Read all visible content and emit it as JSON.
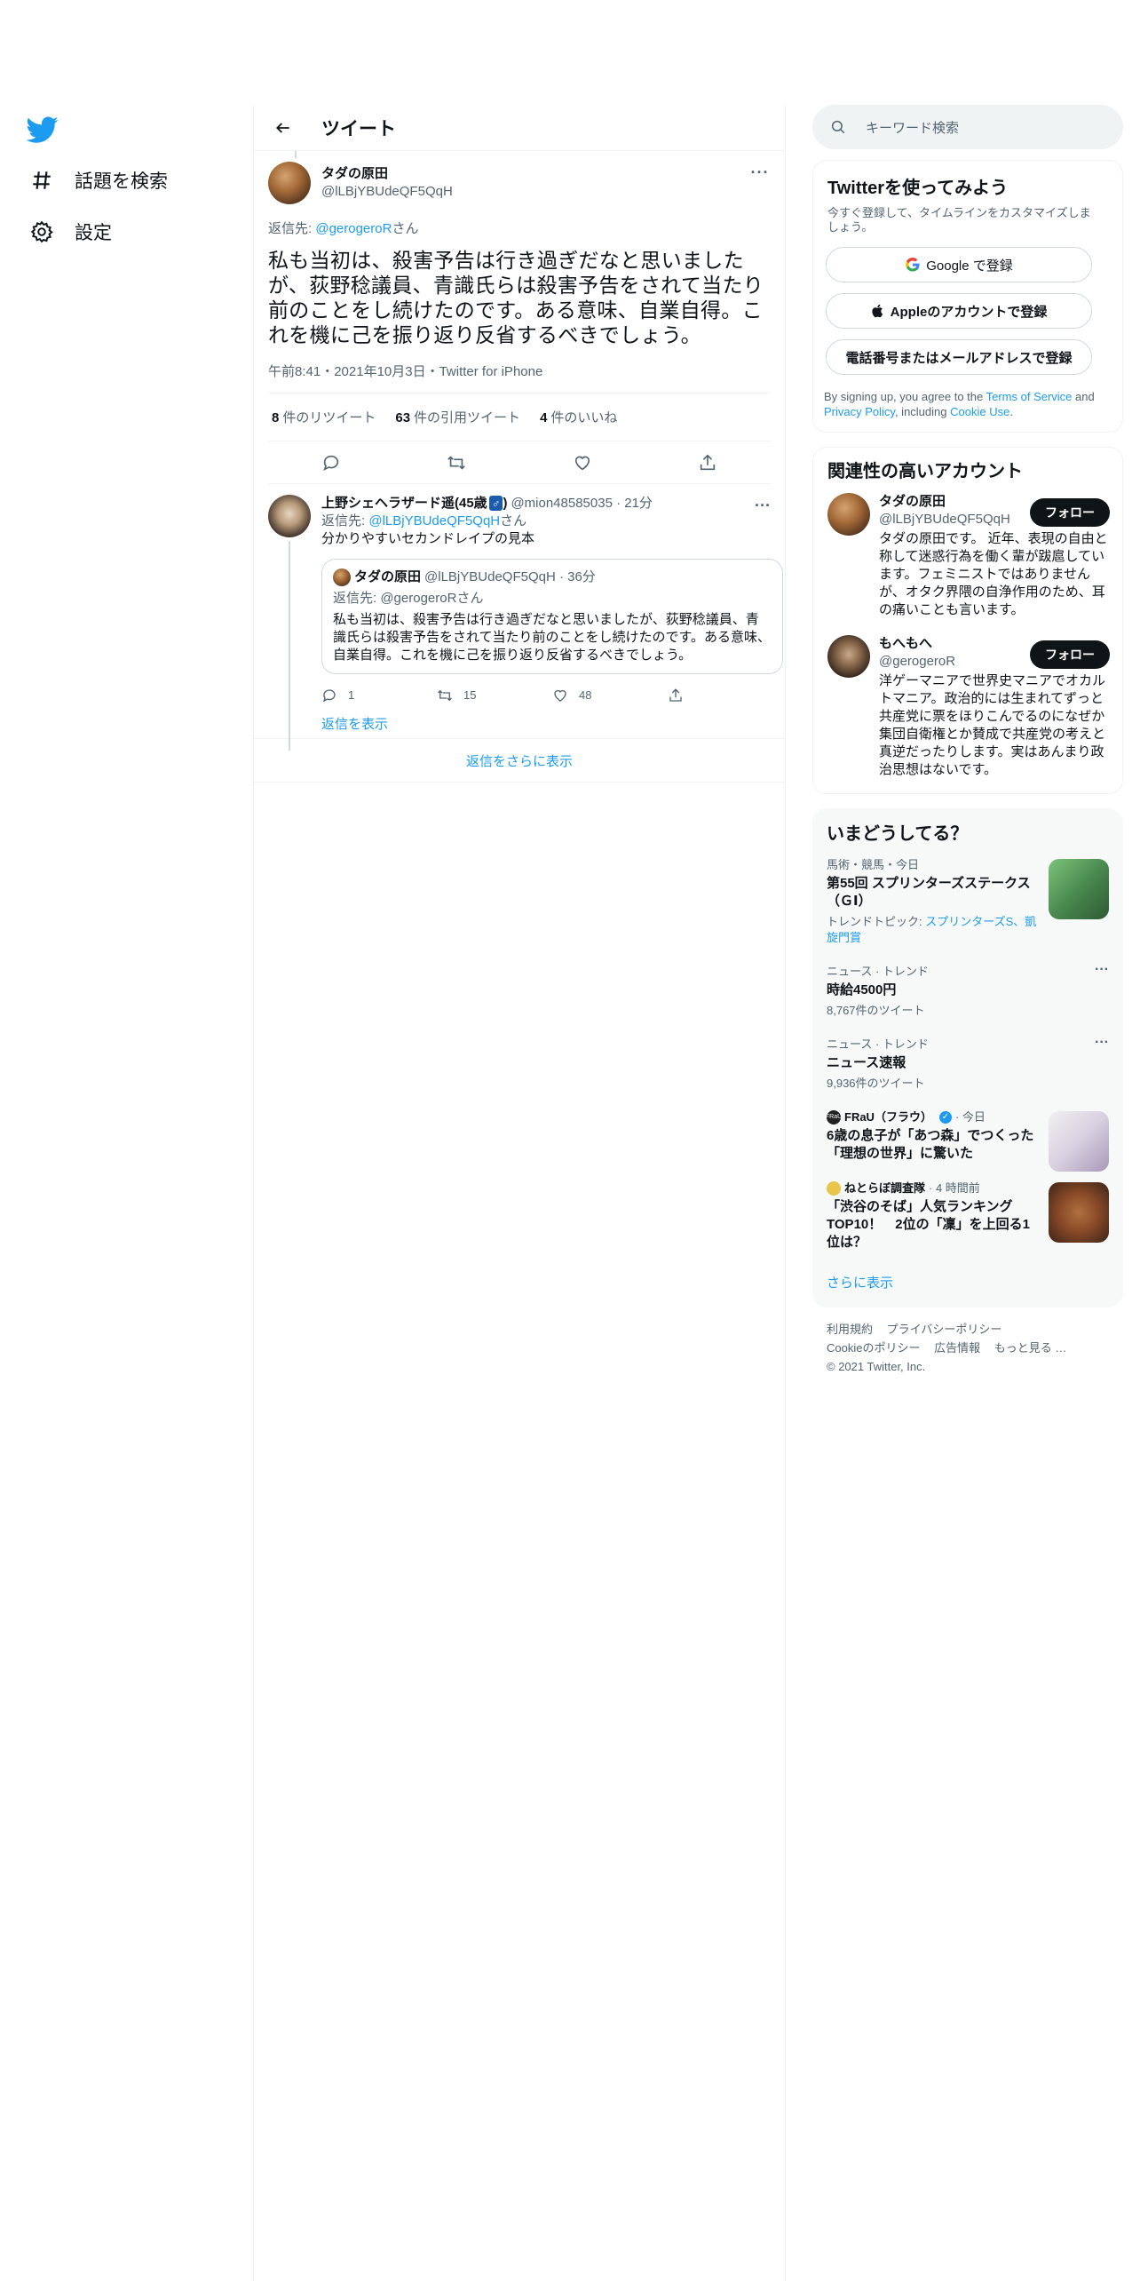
{
  "nav": {
    "items": [
      {
        "icon": "hashtag-icon",
        "label": "話題を検索"
      },
      {
        "icon": "gear-icon",
        "label": "設定"
      }
    ]
  },
  "header": {
    "title": "ツイート"
  },
  "tweet": {
    "name": "タダの原田",
    "handle": "@lLBjYBUdeQF5QqH",
    "reply_prefix": "返信先: ",
    "reply_user": "@gerogeroR",
    "reply_suffix": "さん",
    "text": "私も当初は、殺害予告は行き過ぎだなと思いましたが、荻野稔議員、青識氏らは殺害予告をされて当たり前のことをし続けたのです。ある意味、自業自得。これを機に己を振り返り反省するべきでしょう。",
    "meta": "午前8:41・2021年10月3日・Twitter for iPhone",
    "retweets_count": "8",
    "retweets_label": "件のリツイート",
    "quotes_count": "63",
    "quotes_label": "件の引用ツイート",
    "likes_count": "4",
    "likes_label": "件のいいね"
  },
  "reply": {
    "name": "上野シェヘラザード遥(45歳",
    "tag": "♂",
    "name_close": ")",
    "handle_time": "@mion48585035 · 21分",
    "reply_prefix": "返信先: ",
    "reply_user": "@lLBjYBUdeQF5QqH",
    "reply_suffix": "さん",
    "text": "分かりやすいセカンドレイプの見本",
    "quote": {
      "name": "タダの原田",
      "handle_time": "@lLBjYBUdeQF5QqH · 36分",
      "reply_line": "返信先: @gerogeroRさん",
      "text": "私も当初は、殺害予告は行き過ぎだなと思いましたが、荻野稔議員、青識氏らは殺害予告をされて当たり前のことをし続けたのです。ある意味、自業自得。これを機に己を振り返り反省するべきでしょう。"
    },
    "reply_count": "1",
    "retweet_count": "15",
    "like_count": "48",
    "show_replies": "返信を表示"
  },
  "show_more_replies": "返信をさらに表示",
  "search": {
    "placeholder": "キーワード検索"
  },
  "signup": {
    "title": "Twitterを使ってみよう",
    "subtitle": "今すぐ登録して、タイムラインをカスタマイズしましょう。",
    "google": "Google で登録",
    "apple": "Appleのアカウントで登録",
    "phone": "電話番号またはメールアドレスで登録",
    "terms_a": "By signing up, you agree to the ",
    "terms_link1": "Terms of Service",
    "terms_b": " and ",
    "terms_link2": "Privacy Policy",
    "terms_c": ", including ",
    "terms_link3": "Cookie Use",
    "terms_d": "."
  },
  "related": {
    "title": "関連性の高いアカウント",
    "accounts": [
      {
        "name": "タダの原田",
        "handle": "@lLBjYBUdeQF5QqH",
        "follow": "フォロー",
        "bio": "タダの原田です。 近年、表現の自由と称して迷惑行為を働く輩が跋扈しています。フェミニストではありませんが、オタク界隈の自浄作用のため、耳の痛いことも言います。"
      },
      {
        "name": "もへもへ",
        "handle": "@gerogeroR",
        "follow": "フォロー",
        "bio": "洋ゲーマニアで世界史マニアでオカルトマニア。政治的には生まれてずっと共産党に票をほりこんでるのになぜか集団自衛権とか賛成で共産党の考えと真逆だったりします。実はあんまり政治思想はないです。"
      }
    ]
  },
  "trends": {
    "title": "いまどうしてる？",
    "items": [
      {
        "context": "馬術・競馬・今日",
        "title": "第55回 スプリンターズステークス（ＧⅠ）",
        "topic_label": "トレンドトピック: ",
        "topic_links": "スプリンターズS、凱旋門賞"
      },
      {
        "context": "ニュース · トレンド",
        "title": "時給4500円",
        "count": "8,767件のツイート"
      },
      {
        "context": "ニュース · トレンド",
        "title": "ニュース速報",
        "count": "9,936件のツイート"
      },
      {
        "source": "FRaU（フラウ）",
        "time": "· 今日",
        "title": "6歳の息子が「あつ森」でつくった「理想の世界」に驚いた"
      },
      {
        "source": "ねとらぼ調査隊",
        "time": "· 4 時間前",
        "title": "「渋谷のそば」人気ランキングTOP10！　2位の「凜」を上回る1位は？"
      }
    ],
    "show_more": "さらに表示"
  },
  "footer": {
    "links": [
      "利用規約",
      "プライバシーポリシー",
      "Cookieのポリシー",
      "広告情報",
      "もっと見る …"
    ],
    "copyright": "© 2021 Twitter, Inc."
  },
  "colors": {
    "accent": "#1d9bf0",
    "text": "#0f1419",
    "muted": "#536471"
  }
}
